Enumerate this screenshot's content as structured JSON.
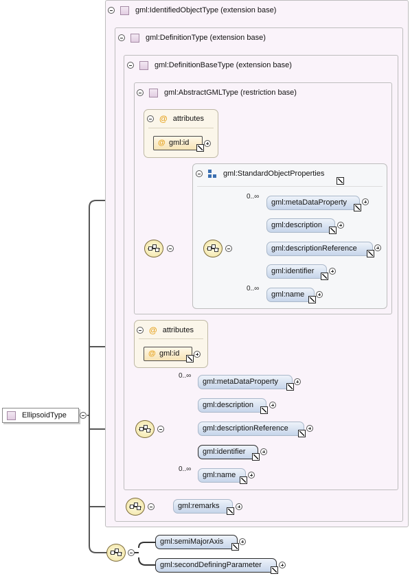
{
  "root": {
    "label": "EllipsoidType"
  },
  "frames": {
    "identified": "gml:IdentifiedObjectType (extension base)",
    "definition": "gml:DefinitionType (extension base)",
    "definition_base": "gml:DefinitionBaseType (extension base)",
    "abstract_gml": "gml:AbstractGMLType (restriction base)"
  },
  "attributes_label": "attributes",
  "attribute_id": "gml:id",
  "standard_props": {
    "title": "gml:StandardObjectProperties",
    "elements": [
      {
        "label": "gml:metaDataProperty",
        "occurrence": "0..∞"
      },
      {
        "label": "gml:description",
        "occurrence": ""
      },
      {
        "label": "gml:descriptionReference",
        "occurrence": ""
      },
      {
        "label": "gml:identifier",
        "occurrence": ""
      },
      {
        "label": "gml:name",
        "occurrence": "0..∞"
      }
    ]
  },
  "definition_elements": [
    {
      "label": "gml:metaDataProperty",
      "occurrence": "0..∞"
    },
    {
      "label": "gml:description",
      "occurrence": ""
    },
    {
      "label": "gml:descriptionReference",
      "occurrence": ""
    },
    {
      "label": "gml:identifier",
      "occurrence": ""
    },
    {
      "label": "gml:name",
      "occurrence": "0..∞"
    }
  ],
  "remarks": "gml:remarks",
  "ellipsoid_elements": [
    "gml:semiMajorAxis",
    "gml:secondDefiningParameter"
  ],
  "icons": {
    "type": "complex-type-icon",
    "attribute": "at-sign-icon",
    "group": "model-group-icon",
    "sequence": "sequence-compositor-icon",
    "collapse": "minus-circle-icon",
    "expand": "plus-circle-icon",
    "reference": "reference-arrow-icon"
  }
}
